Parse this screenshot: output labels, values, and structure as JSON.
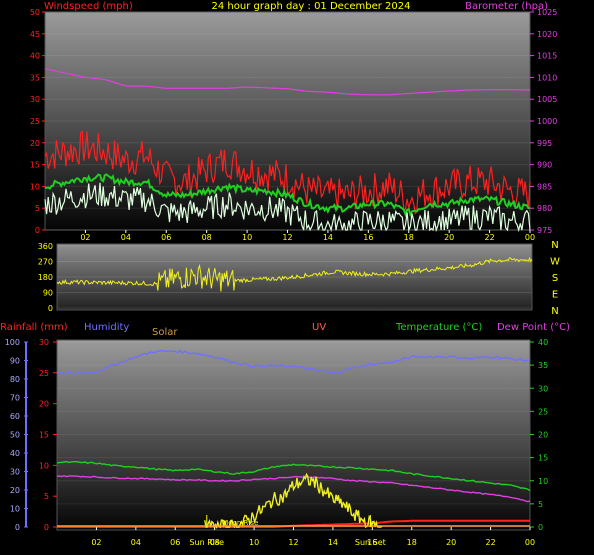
{
  "colors": {
    "red": "#ff2020",
    "green": "#20d020",
    "white": "#e0ffe0",
    "magenta": "#e040e0",
    "yellow": "#f0f020",
    "blue": "#7070ff",
    "orange": "#ffa040",
    "tick": "#ffff00"
  },
  "chart_data": [
    {
      "type": "line",
      "title": "24 hour graph day : 01 December 2024",
      "left_axis_label": "Windspeed (mph)",
      "right_axis_label": "Barometer (hpa)",
      "x_ticks": [
        "02",
        "04",
        "06",
        "08",
        "10",
        "12",
        "14",
        "16",
        "18",
        "20",
        "22",
        "00"
      ],
      "x_range_hours": [
        0,
        24
      ],
      "y_left_range": [
        0,
        50
      ],
      "y_left_ticks": [
        0,
        5,
        10,
        15,
        20,
        25,
        30,
        35,
        40,
        45,
        50
      ],
      "y_right_range": [
        975,
        1025
      ],
      "y_right_ticks": [
        975,
        980,
        985,
        990,
        995,
        1000,
        1005,
        1010,
        1015,
        1020,
        1025
      ],
      "series": [
        {
          "key": "gust",
          "axis": "left",
          "color": "#ff2020",
          "x": [
            0,
            1,
            2,
            3,
            4,
            5,
            6,
            7,
            8,
            9,
            10,
            11,
            12,
            13,
            14,
            15,
            16,
            17,
            18,
            19,
            20,
            21,
            22,
            23,
            24
          ],
          "y": [
            17,
            18,
            19,
            18,
            16,
            17,
            12,
            11,
            14,
            16,
            14,
            13,
            12,
            9,
            8,
            8,
            9,
            10,
            7,
            9,
            10,
            11,
            11,
            9,
            8
          ]
        },
        {
          "key": "avg_speed",
          "axis": "left",
          "color": "#20d020",
          "x": [
            0,
            1,
            2,
            3,
            4,
            5,
            6,
            7,
            8,
            9,
            10,
            11,
            12,
            13,
            14,
            15,
            16,
            17,
            18,
            19,
            20,
            21,
            22,
            23,
            24
          ],
          "y": [
            10,
            11,
            12,
            12,
            11,
            11,
            8,
            8,
            9,
            10,
            9,
            9,
            8,
            6,
            5,
            5,
            6,
            6,
            4,
            6,
            6,
            7,
            7,
            6,
            5
          ]
        },
        {
          "key": "wind_speed",
          "axis": "left",
          "color": "#e0ffe0",
          "x": [
            0,
            1,
            2,
            3,
            4,
            5,
            6,
            7,
            8,
            9,
            10,
            11,
            12,
            13,
            14,
            15,
            16,
            17,
            18,
            19,
            20,
            21,
            22,
            23,
            24
          ],
          "y": [
            6,
            7,
            8,
            8,
            7,
            7,
            4,
            4,
            5,
            6,
            5,
            5,
            4,
            2,
            1,
            1,
            2,
            2,
            1,
            2,
            2,
            3,
            3,
            2,
            2
          ]
        },
        {
          "key": "barometer",
          "axis": "right",
          "color": "#e040e0",
          "x": [
            0,
            1,
            2,
            3,
            4,
            5,
            6,
            7,
            8,
            9,
            10,
            11,
            12,
            13,
            14,
            15,
            16,
            17,
            18,
            19,
            20,
            21,
            22,
            23,
            24
          ],
          "y": [
            1012,
            1011,
            1010,
            1009.5,
            1008,
            1008,
            1007.5,
            1007.5,
            1007.5,
            1007.5,
            1007.8,
            1007.6,
            1007.4,
            1006.8,
            1006.6,
            1006.2,
            1006,
            1006,
            1006.3,
            1006.6,
            1006.9,
            1007.1,
            1007.2,
            1007.2,
            1007.1
          ]
        }
      ]
    },
    {
      "type": "line",
      "x_range_hours": [
        0,
        24
      ],
      "y_left_range": [
        0,
        360
      ],
      "y_left_ticks": [
        0,
        90,
        180,
        270,
        360
      ],
      "compass_labels": [
        "N",
        "W",
        "S",
        "E",
        "N"
      ],
      "series": [
        {
          "key": "wind_direction",
          "axis": "left",
          "color": "#f0f020",
          "x": [
            0,
            1,
            2,
            3,
            4,
            5,
            6,
            7,
            8,
            9,
            10,
            11,
            12,
            13,
            14,
            15,
            16,
            17,
            18,
            19,
            20,
            21,
            22,
            23,
            24
          ],
          "y": [
            150,
            150,
            148,
            146,
            145,
            140,
            170,
            190,
            165,
            160,
            165,
            170,
            180,
            195,
            210,
            200,
            195,
            200,
            215,
            225,
            235,
            250,
            275,
            280,
            280
          ]
        }
      ]
    },
    {
      "type": "line",
      "legend": [
        "Rainfall (mm)",
        "Humidity",
        "Solar",
        "UV",
        "Temperature (°C)",
        "Dew Point (°C)"
      ],
      "x_ticks": [
        "02",
        "04",
        "06",
        "08",
        "10",
        "12",
        "14",
        "16",
        "18",
        "20",
        "22",
        "00"
      ],
      "x_range_hours": [
        0,
        24
      ],
      "humidity_axis": {
        "range": [
          0,
          100
        ],
        "ticks": [
          0,
          10,
          20,
          30,
          40,
          50,
          60,
          70,
          80,
          90,
          100
        ]
      },
      "rain_axis": {
        "range": [
          0,
          30
        ],
        "ticks": [
          0,
          5,
          10,
          15,
          20,
          25,
          30
        ]
      },
      "temp_axis": {
        "range": [
          0,
          40
        ],
        "ticks": [
          0,
          5,
          10,
          15,
          20,
          25,
          30,
          35,
          40
        ]
      },
      "annotations": [
        {
          "text": "Sun Rise",
          "x": 7.6
        },
        {
          "text": "Sun Set",
          "x": 15.9
        },
        {
          "text": "Moon Rise",
          "x": 9.3
        }
      ],
      "series": [
        {
          "key": "humidity",
          "axis": "humidity",
          "color": "#7070ff",
          "x": [
            0,
            1,
            2,
            3,
            4,
            5,
            6,
            7,
            8,
            9,
            10,
            11,
            12,
            13,
            14,
            15,
            16,
            17,
            18,
            19,
            20,
            21,
            22,
            23,
            24
          ],
          "y": [
            83,
            83,
            84,
            88,
            92,
            95,
            95,
            94,
            92,
            89,
            87,
            87,
            87,
            85,
            83,
            86,
            88,
            89,
            92,
            92,
            92,
            91,
            92,
            91,
            90
          ]
        },
        {
          "key": "temperature",
          "axis": "temp",
          "color": "#20d020",
          "x": [
            0,
            1,
            2,
            3,
            4,
            5,
            6,
            7,
            8,
            9,
            10,
            11,
            12,
            13,
            14,
            15,
            16,
            17,
            18,
            19,
            20,
            21,
            22,
            23,
            24
          ],
          "y": [
            14,
            14,
            13.8,
            13.2,
            13,
            12.5,
            12.2,
            12.5,
            12,
            11.5,
            12,
            13,
            13.5,
            13.2,
            13,
            12.8,
            12.5,
            12.2,
            11.5,
            11,
            10.5,
            10,
            9.5,
            9,
            8
          ]
        },
        {
          "key": "dew_point",
          "axis": "temp",
          "color": "#e040e0",
          "x": [
            0,
            1,
            2,
            3,
            4,
            5,
            6,
            7,
            8,
            9,
            10,
            11,
            12,
            13,
            14,
            15,
            16,
            17,
            18,
            19,
            20,
            21,
            22,
            23,
            24
          ],
          "y": [
            11,
            11,
            10.8,
            10.6,
            10.5,
            10.4,
            10.2,
            10.2,
            10,
            10,
            10.3,
            10.5,
            10.8,
            10.8,
            10.5,
            10,
            9.8,
            9.5,
            9,
            8.5,
            8,
            7.5,
            7,
            6.5,
            5.5
          ]
        },
        {
          "key": "rainfall",
          "axis": "rain",
          "color": "#ff2020",
          "x": [
            0,
            1,
            2,
            3,
            4,
            5,
            6,
            7,
            8,
            9,
            10,
            11,
            12,
            13,
            14,
            15,
            16,
            17,
            18,
            19,
            20,
            21,
            22,
            23,
            24
          ],
          "y": [
            0,
            0,
            0,
            0,
            0,
            0,
            0,
            0,
            0,
            0,
            0,
            0,
            0.2,
            0.3,
            0.4,
            0.5,
            0.6,
            0.9,
            1,
            1,
            1,
            1,
            1,
            1,
            1
          ]
        },
        {
          "key": "solar",
          "axis": "temp",
          "color": "#f0f020",
          "x": [
            7.5,
            8,
            9,
            9.5,
            10,
            10.5,
            11,
            11.5,
            12,
            12.5,
            13,
            13.5,
            14,
            14.5,
            15,
            15.5,
            16,
            16.5
          ],
          "y": [
            0,
            0,
            0.2,
            1,
            2.5,
            4,
            6,
            6.5,
            9,
            10,
            10,
            8,
            6,
            5,
            3,
            1.5,
            0.5,
            0
          ]
        }
      ]
    }
  ]
}
